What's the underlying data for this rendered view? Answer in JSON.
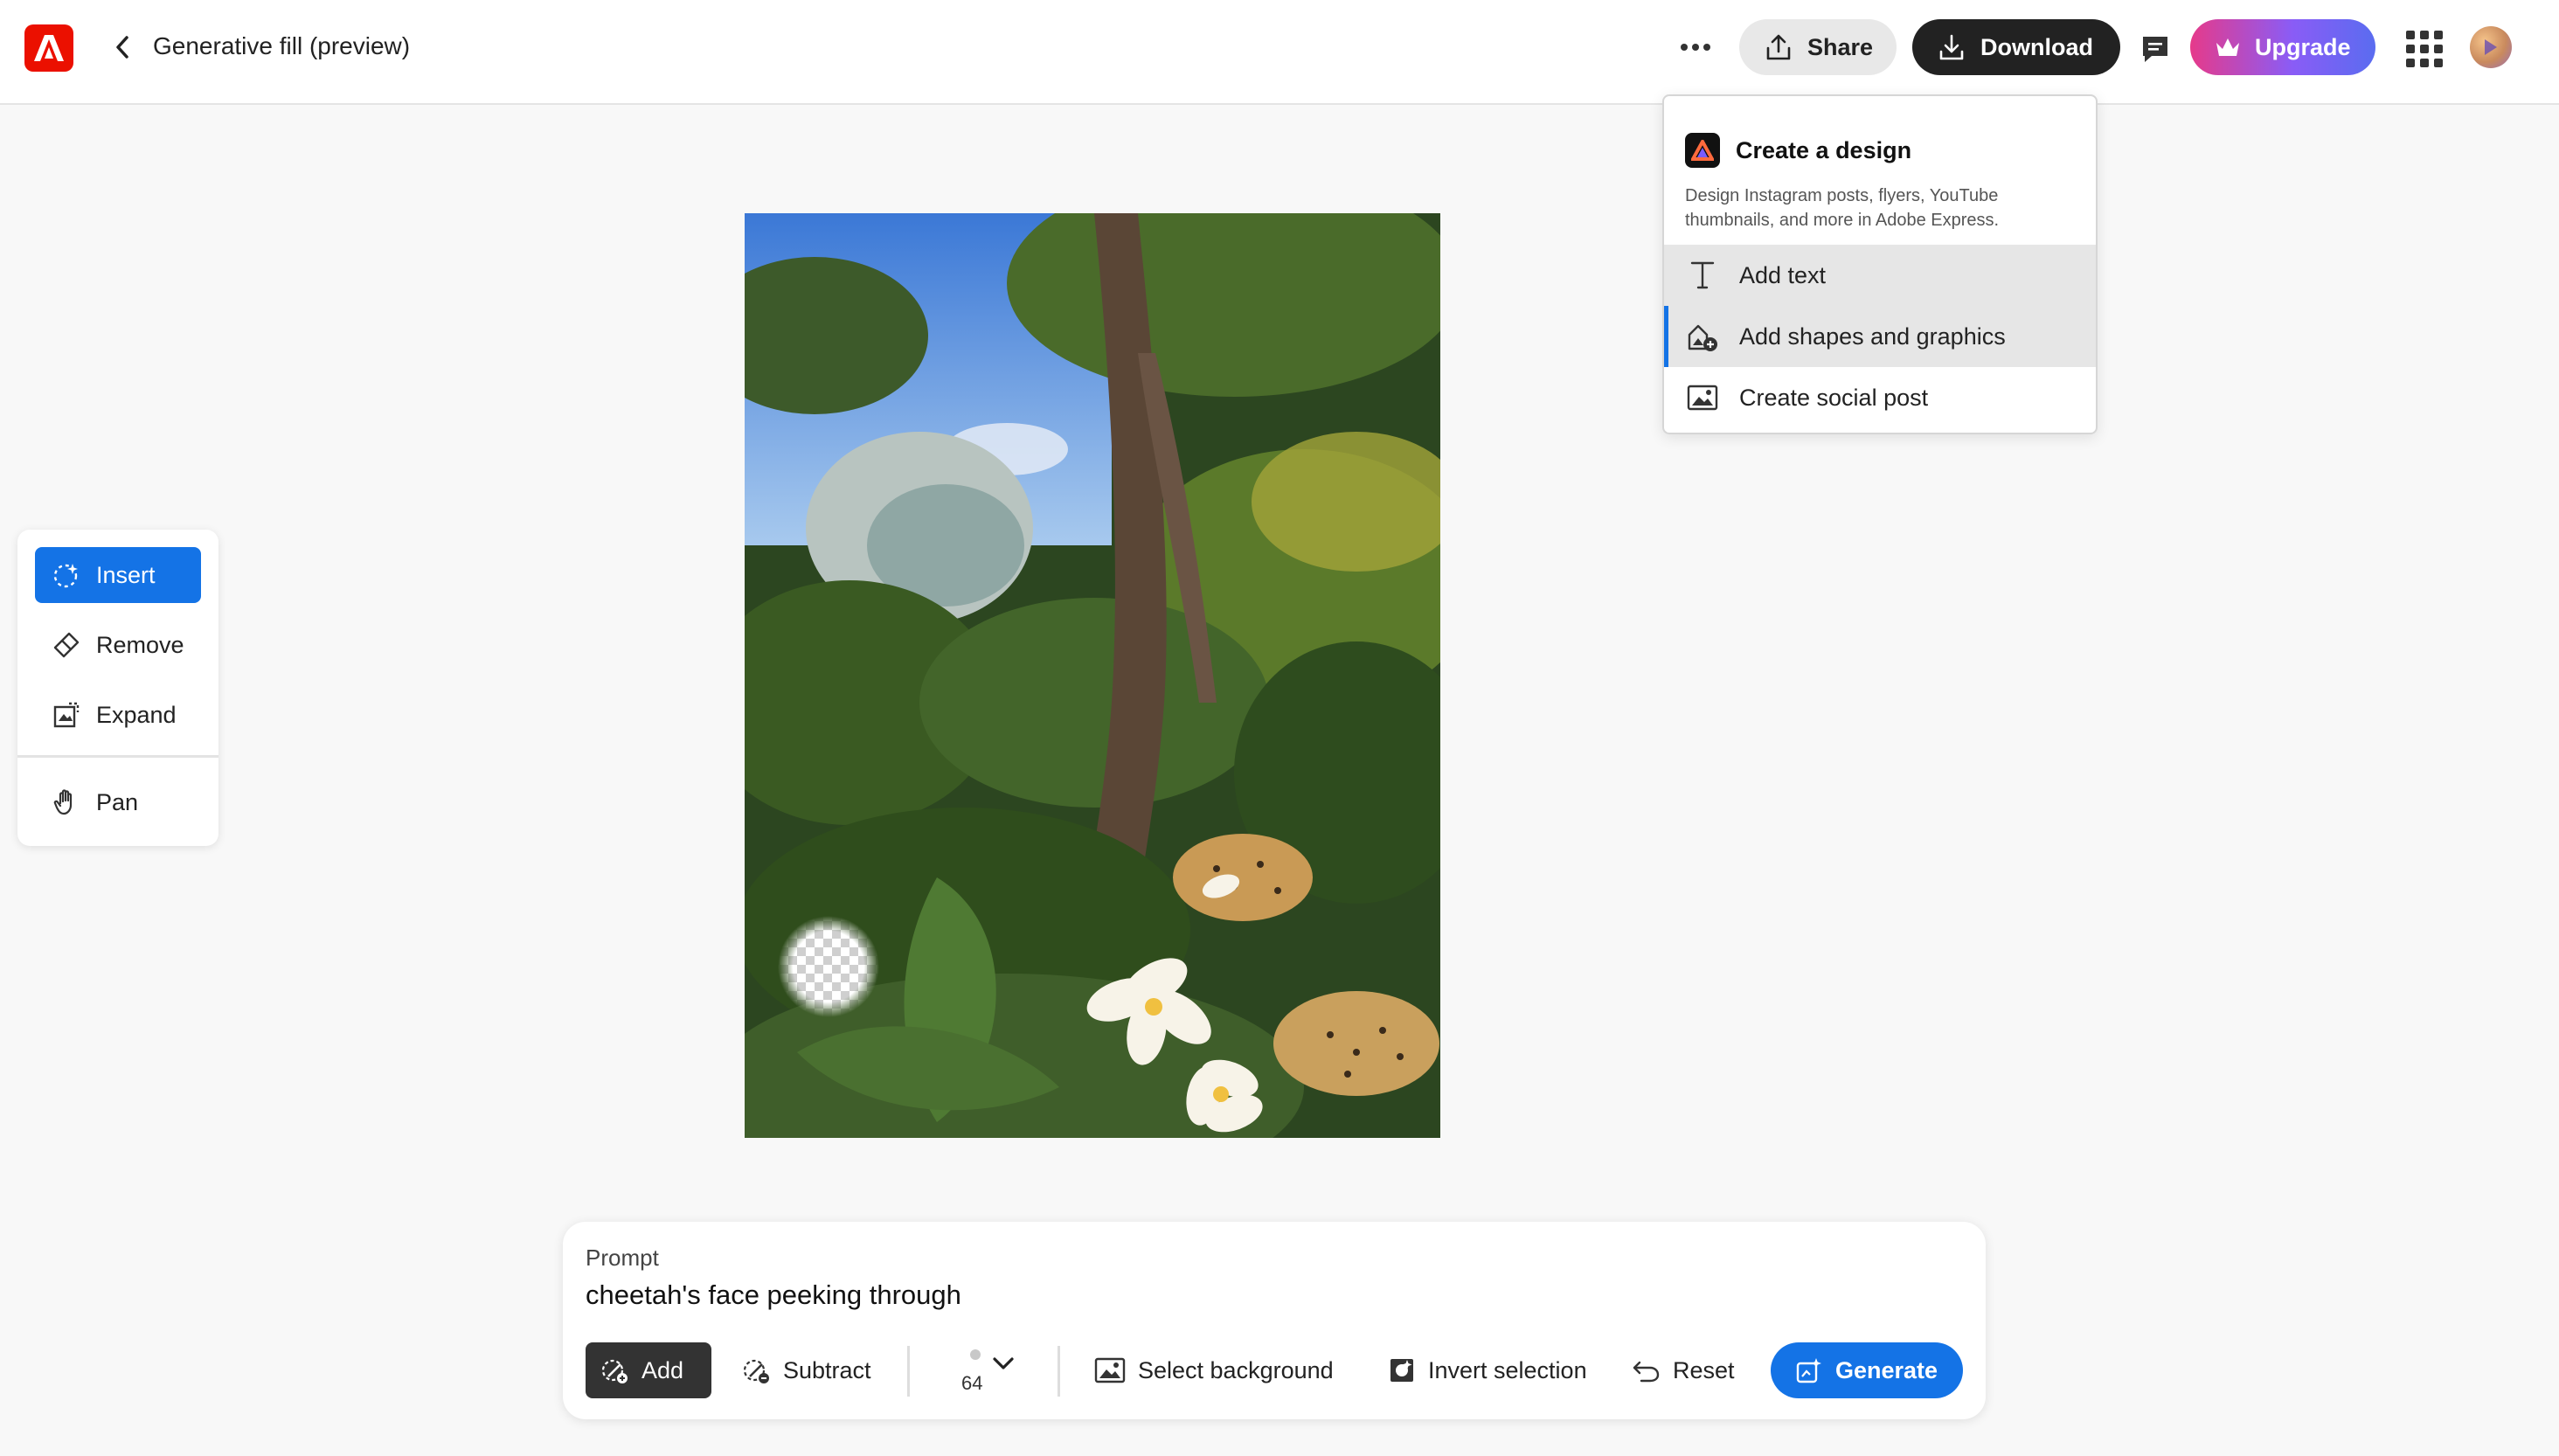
{
  "header": {
    "title": "Generative fill (preview)",
    "share_label": "Share",
    "download_label": "Download",
    "upgrade_label": "Upgrade"
  },
  "menu": {
    "heading": "Create a design",
    "description": "Design Instagram posts, flyers, YouTube thumbnails, and more in Adobe Express.",
    "items": [
      {
        "label": "Add text",
        "icon": "text-icon"
      },
      {
        "label": "Add shapes and graphics",
        "icon": "shapes-icon"
      },
      {
        "label": "Create social post",
        "icon": "image-icon"
      }
    ]
  },
  "tools": {
    "items": [
      {
        "label": "Insert",
        "icon": "insert-icon",
        "active": true
      },
      {
        "label": "Remove",
        "icon": "eraser-icon"
      },
      {
        "label": "Expand",
        "icon": "expand-icon"
      },
      {
        "label": "Pan",
        "icon": "hand-icon"
      }
    ]
  },
  "prompt": {
    "label": "Prompt",
    "value": "cheetah's face peeking through",
    "add_label": "Add",
    "subtract_label": "Subtract",
    "brush_size": "64",
    "select_background_label": "Select background",
    "invert_selection_label": "Invert selection",
    "reset_label": "Reset",
    "generate_label": "Generate"
  },
  "colors": {
    "accent": "#1473e6",
    "brand": "#eb1000",
    "dark_button": "#222222"
  }
}
